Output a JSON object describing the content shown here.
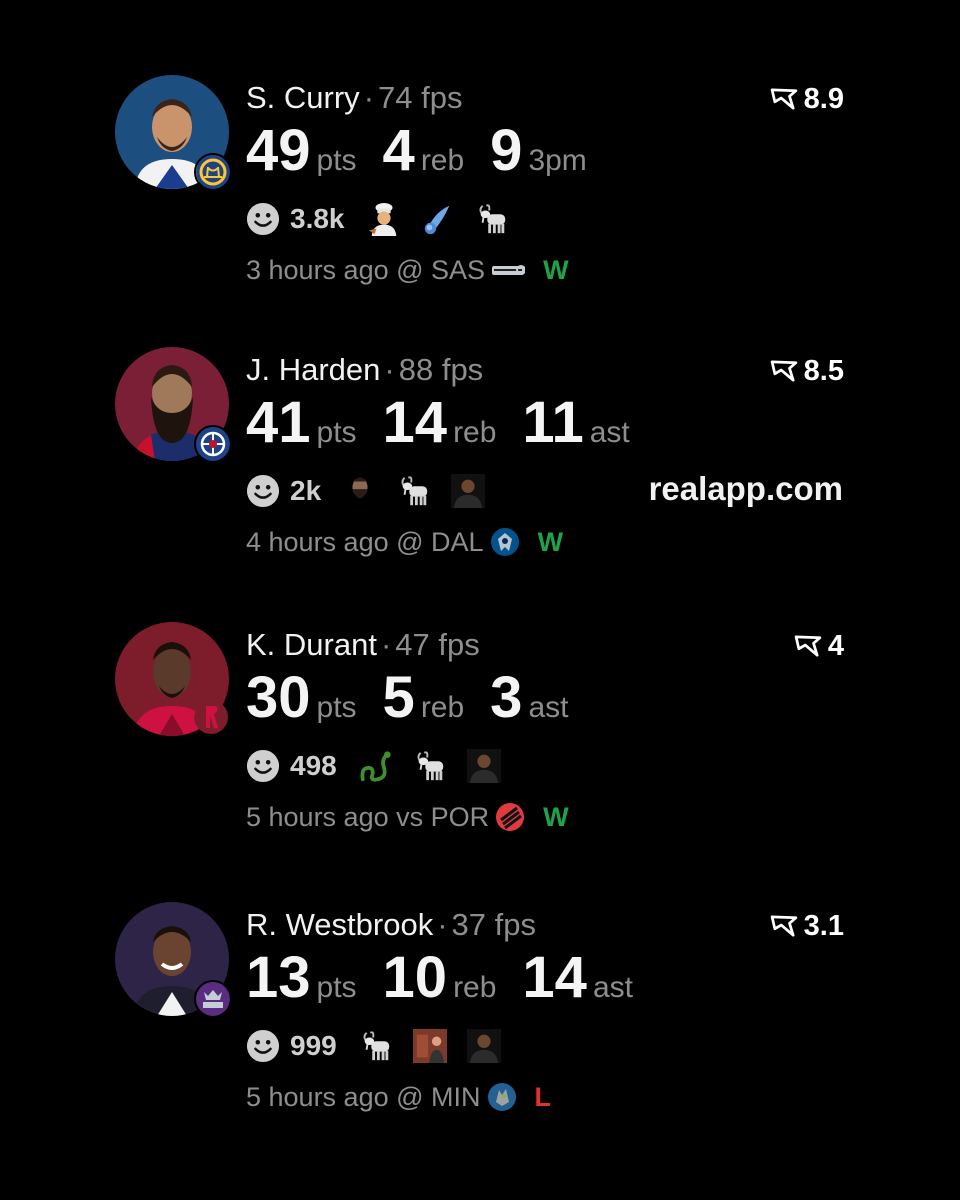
{
  "colors": {
    "background": "#000000",
    "win": "#1fa34a",
    "loss": "#e0312f",
    "muted_text": "#8e8e8e"
  },
  "watermark": "realapp.com",
  "cards": [
    {
      "name": "S. Curry",
      "separator": "·",
      "fps": "74 fps",
      "rating": "8.9",
      "stats": [
        {
          "value": "49",
          "unit": "pts"
        },
        {
          "value": "4",
          "unit": "reb"
        },
        {
          "value": "9",
          "unit": "3pm"
        }
      ],
      "reaction_count": "3.8k",
      "reaction_icons": [
        "chef-emoji-icon",
        "comet-emoji-icon",
        "goat-emoji-icon"
      ],
      "time": "3 hours ago",
      "location": "@ SAS",
      "opponent_icon": "spurs-logo-icon",
      "result": "W",
      "team_icon": "warriors-logo-icon"
    },
    {
      "name": "J. Harden",
      "separator": "·",
      "fps": "88 fps",
      "rating": "8.5",
      "stats": [
        {
          "value": "41",
          "unit": "pts"
        },
        {
          "value": "14",
          "unit": "reb"
        },
        {
          "value": "11",
          "unit": "ast"
        }
      ],
      "reaction_count": "2k",
      "reaction_icons": [
        "harden-face-icon",
        "goat-emoji-icon",
        "player-photo-icon"
      ],
      "time": "4 hours ago",
      "location": "@ DAL",
      "opponent_icon": "mavericks-logo-icon",
      "result": "W",
      "team_icon": "clippers-logo-icon"
    },
    {
      "name": "K. Durant",
      "separator": "·",
      "fps": "47 fps",
      "rating": "4",
      "stats": [
        {
          "value": "30",
          "unit": "pts"
        },
        {
          "value": "5",
          "unit": "reb"
        },
        {
          "value": "3",
          "unit": "ast"
        }
      ],
      "reaction_count": "498",
      "reaction_icons": [
        "snake-icon",
        "goat-emoji-icon",
        "player-photo-icon"
      ],
      "time": "5 hours ago",
      "location": "vs POR",
      "opponent_icon": "blazers-logo-icon",
      "result": "W",
      "team_icon": "rockets-logo-icon"
    },
    {
      "name": "R. Westbrook",
      "separator": "·",
      "fps": "37 fps",
      "rating": "3.1",
      "stats": [
        {
          "value": "13",
          "unit": "pts"
        },
        {
          "value": "10",
          "unit": "reb"
        },
        {
          "value": "14",
          "unit": "ast"
        }
      ],
      "reaction_count": "999",
      "reaction_icons": [
        "goat-emoji-icon",
        "photo-thumbnail-icon",
        "player-photo-icon"
      ],
      "time": "5 hours ago",
      "location": "@ MIN",
      "opponent_icon": "timberwolves-logo-icon",
      "result": "L",
      "team_icon": "kings-logo-icon"
    }
  ]
}
